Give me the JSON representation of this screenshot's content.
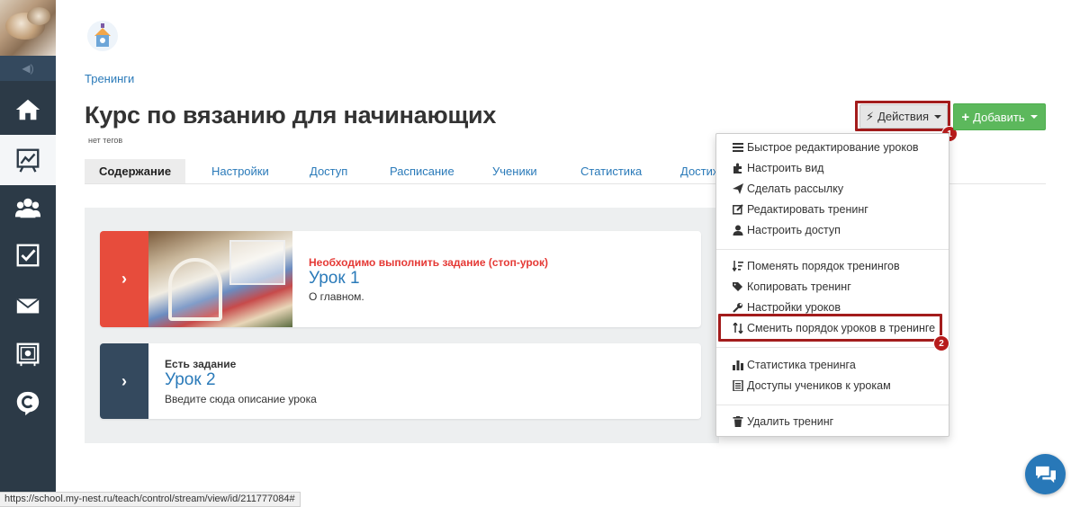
{
  "breadcrumb": "Тренинги",
  "page": {
    "title": "Курс по вязанию для начинающих",
    "tags": "нет тегов"
  },
  "toolbar": {
    "actions_label": "Действия",
    "add_label": "Добавить",
    "badge_1": "1",
    "badge_2": "2"
  },
  "tabs": [
    {
      "label": "Содержание",
      "active": true
    },
    {
      "label": "Настройки"
    },
    {
      "label": "Доступ"
    },
    {
      "label": "Расписание"
    },
    {
      "label": "Ученики"
    },
    {
      "label": "Статистика"
    },
    {
      "label": "Достиж"
    }
  ],
  "lessons": [
    {
      "status": "Необходимо выполнить задание (стоп-урок)",
      "title": "Урок 1",
      "description": "О главном.",
      "handle_color": "#e74c3c"
    },
    {
      "status": "Есть задание",
      "title": "Урок 2",
      "description": "Введите сюда описание урока",
      "handle_color": "#34495e"
    }
  ],
  "menu": {
    "items": [
      {
        "label": "Быстрое редактирование уроков",
        "icon": "list-icon"
      },
      {
        "label": "Настроить вид",
        "icon": "puzzle-icon"
      },
      {
        "label": "Сделать рассылку",
        "icon": "send-icon"
      },
      {
        "label": "Редактировать тренинг",
        "icon": "edit-icon"
      },
      {
        "label": "Настроить доступ",
        "icon": "user-icon"
      },
      {
        "label": "Поменять порядок тренингов",
        "icon": "sort-icon"
      },
      {
        "label": "Копировать тренинг",
        "icon": "tags-icon"
      },
      {
        "label": "Настройки уроков",
        "icon": "wrench-icon"
      },
      {
        "label": "Сменить порядок уроков в тренинге",
        "icon": "sort-arrows-icon"
      },
      {
        "label": "Статистика тренинга",
        "icon": "bar-chart-icon"
      },
      {
        "label": "Доступы учеников к урокам",
        "icon": "document-icon"
      },
      {
        "label": "Удалить тренинг",
        "icon": "trash-icon"
      }
    ]
  },
  "statusbar": "https://school.my-nest.ru/teach/control/stream/view/id/211777084#",
  "colors": {
    "sidebar": "#2c3a47",
    "link": "#2a7ab9",
    "success": "#5cb85c",
    "highlight": "#a31c1c",
    "warning_text": "#e53935",
    "chat": "#2878b8"
  }
}
